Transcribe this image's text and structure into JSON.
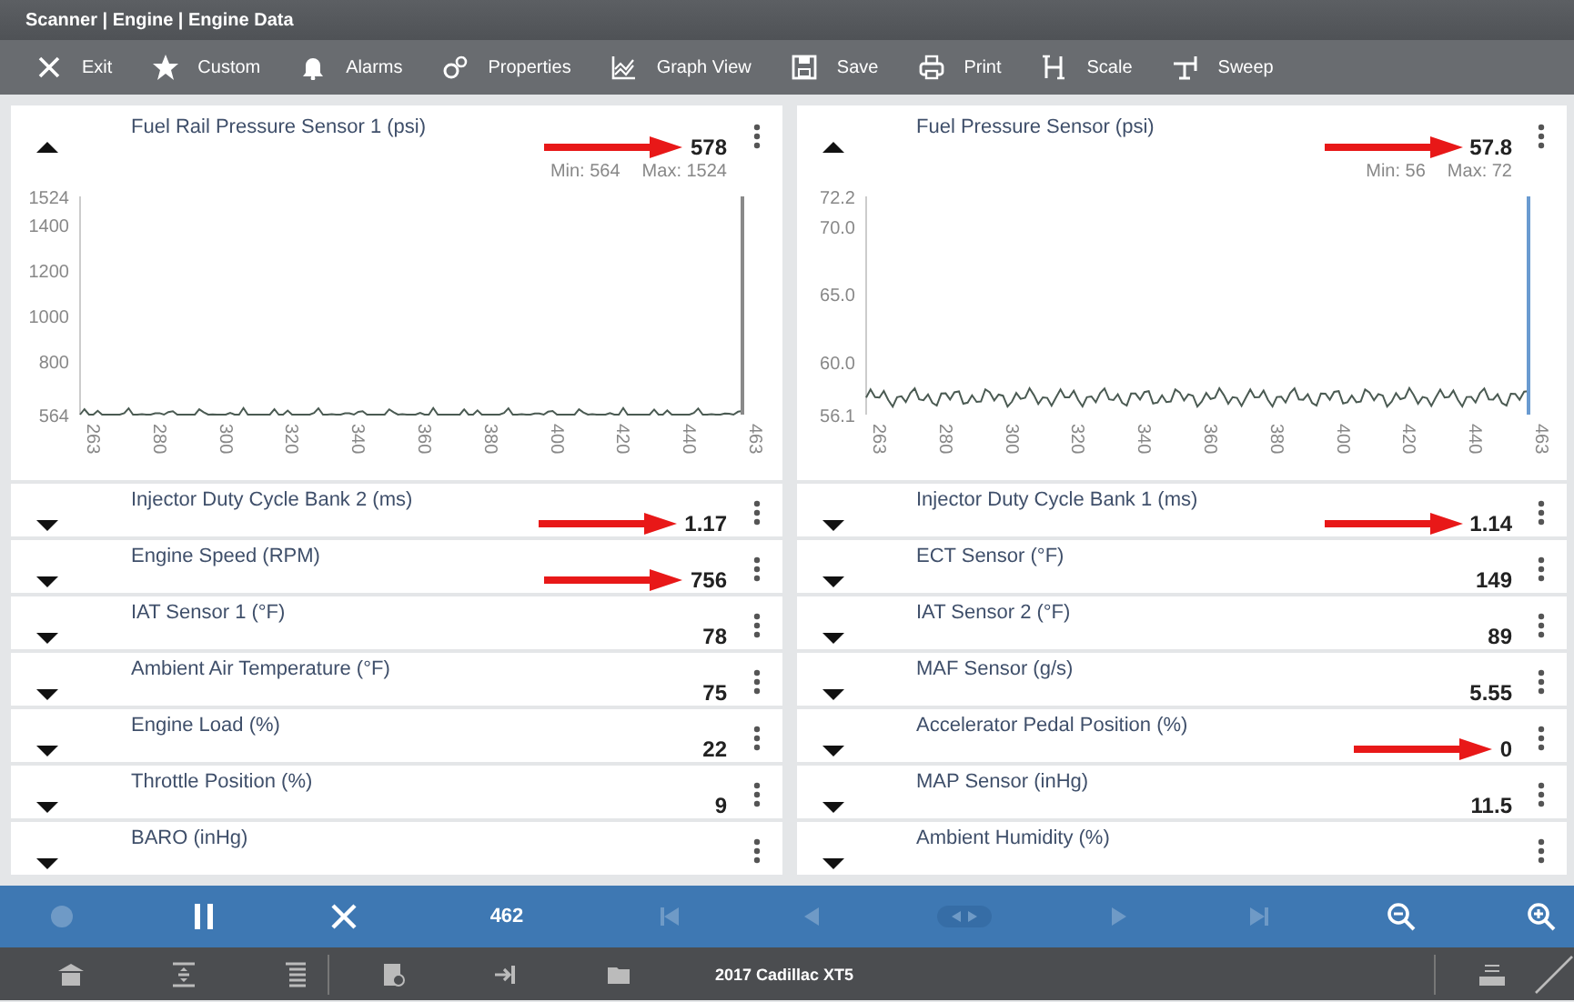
{
  "window": {
    "title": "Scanner | Engine | Engine Data"
  },
  "toolbar": [
    {
      "kind": "close",
      "label": "Exit"
    },
    {
      "kind": "star",
      "label": "Custom"
    },
    {
      "kind": "bell",
      "label": "Alarms"
    },
    {
      "kind": "gears",
      "label": "Properties"
    },
    {
      "kind": "graph",
      "label": "Graph View"
    },
    {
      "kind": "save",
      "label": "Save"
    },
    {
      "kind": "print",
      "label": "Print"
    },
    {
      "kind": "scale",
      "label": "Scale"
    },
    {
      "kind": "sweep",
      "label": "Sweep"
    }
  ],
  "columns": [
    {
      "graph": {
        "title": "Fuel Rail Pressure Sensor 1 (psi)",
        "value": "578",
        "arrow": true,
        "expanded": true,
        "min": "Min: 564",
        "max": "Max: 1524",
        "cursor": {
          "color": "#8a8a8a"
        },
        "y_ticks": [
          "1524",
          "1400",
          "1200",
          "1000",
          "800",
          "564"
        ],
        "x_ticks": [
          "263",
          "280",
          "300",
          "320",
          "340",
          "360",
          "380",
          "400",
          "420",
          "440",
          "463"
        ]
      },
      "rows": [
        {
          "label": "Injector Duty Cycle Bank 2 (ms)",
          "value": "1.17",
          "arrow": true,
          "expanded": false
        },
        {
          "label": "Engine Speed (RPM)",
          "value": "756",
          "arrow": true,
          "expanded": false
        },
        {
          "label": "IAT Sensor 1 (°F)",
          "value": "78",
          "arrow": false,
          "expanded": false
        },
        {
          "label": "Ambient Air Temperature (°F)",
          "value": "75",
          "arrow": false,
          "expanded": false
        },
        {
          "label": "Engine Load (%)",
          "value": "22",
          "arrow": false,
          "expanded": false
        },
        {
          "label": "Throttle Position (%)",
          "value": "9",
          "arrow": false,
          "expanded": false
        },
        {
          "label": "BARO (inHg)",
          "arrow": false,
          "expanded": false
        }
      ]
    },
    {
      "graph": {
        "title": "Fuel Pressure Sensor (psi)",
        "value": "57.8",
        "arrow": true,
        "expanded": true,
        "min": "Min: 56",
        "max": "Max: 72",
        "cursor": {
          "color": "#6a9bd0"
        },
        "y_ticks": [
          "72.2",
          "70.0",
          "65.0",
          "60.0",
          "56.1"
        ],
        "x_ticks": [
          "263",
          "280",
          "300",
          "320",
          "340",
          "360",
          "380",
          "400",
          "420",
          "440",
          "463"
        ]
      },
      "rows": [
        {
          "label": "Injector Duty Cycle Bank 1 (ms)",
          "value": "1.14",
          "arrow": true,
          "expanded": false
        },
        {
          "label": "ECT Sensor (°F)",
          "value": "149",
          "arrow": false,
          "expanded": false
        },
        {
          "label": "IAT Sensor 2 (°F)",
          "value": "89",
          "arrow": false,
          "expanded": false
        },
        {
          "label": "MAF Sensor (g/s)",
          "value": "5.55",
          "arrow": false,
          "expanded": false
        },
        {
          "label": "Accelerator Pedal Position (%)",
          "value": "0",
          "arrow": true,
          "expanded": false
        },
        {
          "label": "MAP Sensor (inHg)",
          "value": "11.5",
          "arrow": false,
          "expanded": false
        },
        {
          "label": "Ambient Humidity (%)",
          "arrow": false,
          "expanded": false
        }
      ]
    }
  ],
  "playback": {
    "frame": "462",
    "controls": [
      {
        "kind": "record",
        "disabled": true
      },
      {
        "kind": "pause",
        "disabled": false
      },
      {
        "kind": "stop",
        "disabled": false
      },
      {
        "kind": "frame"
      },
      {
        "kind": "first",
        "disabled": true
      },
      {
        "kind": "back",
        "disabled": true
      },
      {
        "kind": "jog",
        "disabled": true
      },
      {
        "kind": "forward",
        "disabled": true
      },
      {
        "kind": "last",
        "disabled": true
      },
      {
        "kind": "zoom-out",
        "disabled": false
      },
      {
        "kind": "zoom-in",
        "disabled": false
      }
    ]
  },
  "taskbar": {
    "vehicle": "2017 Cadillac XT5"
  }
}
